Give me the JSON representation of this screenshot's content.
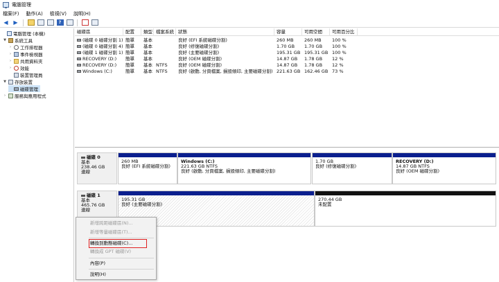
{
  "window": {
    "title": "電腦管理"
  },
  "menu": [
    "檔案(F)",
    "動作(A)",
    "檢視(V)",
    "說明(H)"
  ],
  "toolbar_icons": [
    "back-arrow-icon",
    "forward-arrow-icon",
    "up-folder-icon",
    "show-hide-tree-icon",
    "properties-icon",
    "help-icon",
    "connect-icon",
    "check-icon",
    "view-icon"
  ],
  "tree": [
    {
      "label": "電腦管理 (本機)",
      "level": 0,
      "icon": "computer-icon",
      "expander": ""
    },
    {
      "label": "系統工具",
      "level": 1,
      "icon": "tools-icon",
      "expander": "▼"
    },
    {
      "label": "工作排程器",
      "level": 2,
      "icon": "clock-icon",
      "expander": "›"
    },
    {
      "label": "事件檢視器",
      "level": 2,
      "icon": "event-icon",
      "expander": "›"
    },
    {
      "label": "共用資料夾",
      "level": 2,
      "icon": "folder-icon",
      "expander": "›"
    },
    {
      "label": "效能",
      "level": 2,
      "icon": "performance-icon",
      "expander": "›"
    },
    {
      "label": "裝置管理員",
      "level": 2,
      "icon": "device-icon",
      "expander": ""
    },
    {
      "label": "存放裝置",
      "level": 1,
      "icon": "storage-icon",
      "expander": "▼"
    },
    {
      "label": "磁碟管理",
      "level": 2,
      "icon": "disk-icon",
      "expander": "",
      "selected": true
    },
    {
      "label": "服務與應用程式",
      "level": 1,
      "icon": "services-icon",
      "expander": "›"
    }
  ],
  "volumes": {
    "columns": [
      "磁碟區",
      "配置",
      "類型",
      "檔案系統",
      "狀態",
      "容量",
      "可用空間",
      "可用百分比"
    ],
    "rows": [
      [
        "(磁碟 0 磁碟分割 1)",
        "簡單",
        "基本",
        "",
        "良好 (EFI 系統磁碟分割)",
        "260 MB",
        "260 MB",
        "100 %"
      ],
      [
        "(磁碟 0 磁碟分割 4)",
        "簡單",
        "基本",
        "",
        "良好 (修復磁碟分割)",
        "1.70 GB",
        "1.70 GB",
        "100 %"
      ],
      [
        "(磁碟 1 磁碟分割 1)",
        "簡單",
        "基本",
        "",
        "良好 (主要磁碟分割)",
        "195.31 GB",
        "195.31 GB",
        "100 %"
      ],
      [
        "RECOVERY (D:)",
        "簡單",
        "基本",
        "",
        "良好 (OEM 磁碟分割)",
        "14.87 GB",
        "1.78 GB",
        "12 %"
      ],
      [
        "RECOVERY (D:)",
        "簡單",
        "基本",
        "NTFS",
        "良好 (OEM 磁碟分割)",
        "14.87 GB",
        "1.78 GB",
        "12 %"
      ],
      [
        "Windows (C:)",
        "簡單",
        "基本",
        "NTFS",
        "良好 (啟動, 分頁檔案, 損毀傾印, 主要磁碟分割)",
        "221.63 GB",
        "162.46 GB",
        "73 %"
      ]
    ]
  },
  "disks": [
    {
      "name": "磁碟 0",
      "type": "基本",
      "size": "238.46 GB",
      "status": "連線",
      "partitions": [
        {
          "name": "",
          "size": "260 MB",
          "status": "良好 (EFI 系統磁碟分割)",
          "kind": "primary"
        },
        {
          "name": "Windows (C:)",
          "size": "221.63 GB NTFS",
          "status": "良好 (啟動, 分頁檔案, 損毀傾印, 主要磁碟分割)",
          "kind": "primary"
        },
        {
          "name": "",
          "size": "1.70 GB",
          "status": "良好 (修復磁碟分割)",
          "kind": "primary"
        },
        {
          "name": "RECOVERY (D:)",
          "size": "14.87 GB NTFS",
          "status": "良好 (OEM 磁碟分割)",
          "kind": "primary"
        }
      ]
    },
    {
      "name": "磁碟 1",
      "type": "基本",
      "size": "465.76 GB",
      "status": "連線",
      "partitions": [
        {
          "name": "",
          "size": "195.31 GB",
          "status": "良好 (主要磁碟分割)",
          "kind": "primary"
        },
        {
          "name": "",
          "size": "270.44 GB",
          "status": "未配置",
          "kind": "unallocated"
        }
      ]
    }
  ],
  "context_menu": [
    {
      "label": "新增跨距磁碟區(N)...",
      "disabled": true
    },
    {
      "label": "新增等量磁碟區(T)...",
      "disabled": true
    },
    {
      "label": "轉換到動態磁碟(C)...",
      "disabled": false,
      "highlighted": true
    },
    {
      "label": "轉換成 GPT 磁碟(V)",
      "disabled": true
    },
    {
      "label": "內容(P)",
      "disabled": false
    },
    {
      "label": "說明(H)",
      "disabled": false
    }
  ]
}
